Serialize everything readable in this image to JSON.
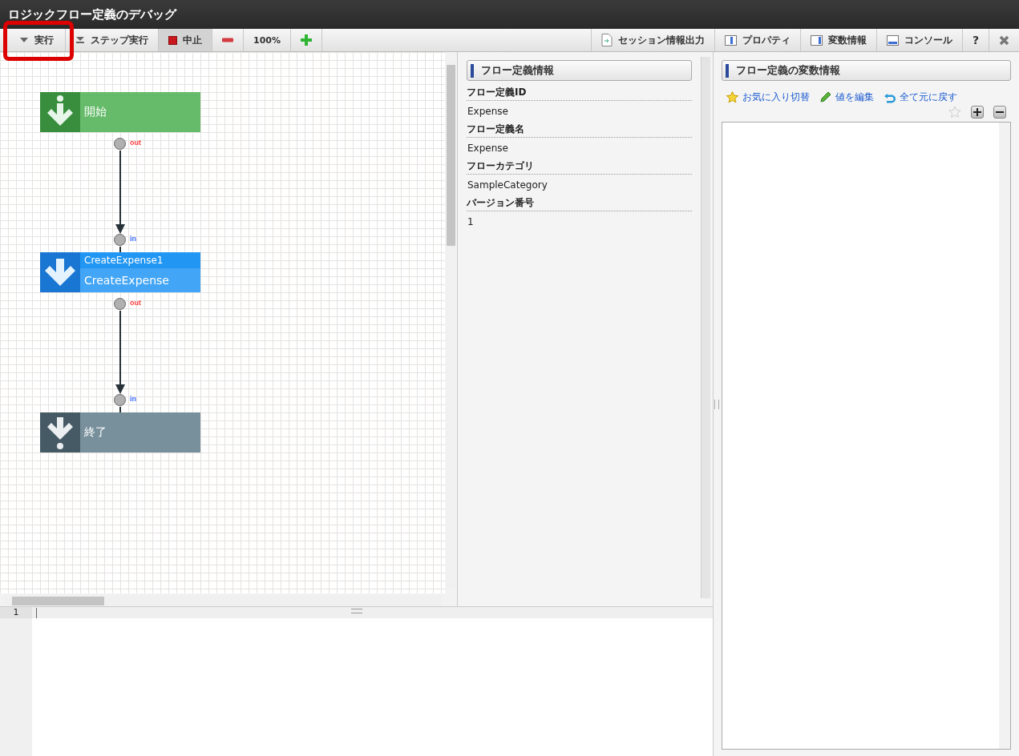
{
  "window": {
    "title": "ロジックフロー定義のデバッグ"
  },
  "toolbar": {
    "left": [
      {
        "kind": "run",
        "label": "実行",
        "highlighted": true,
        "pressed": false
      },
      {
        "kind": "step",
        "label": "ステップ実行",
        "highlighted": false,
        "pressed": false
      },
      {
        "kind": "stop",
        "label": "中止",
        "highlighted": false,
        "pressed": true
      },
      {
        "kind": "zoom-out",
        "highlighted": false,
        "pressed": false
      },
      {
        "kind": "zoom",
        "label": "100%",
        "highlighted": false,
        "pressed": false
      },
      {
        "kind": "zoom-in",
        "highlighted": false,
        "pressed": false
      }
    ],
    "right": [
      {
        "kind": "export",
        "label": "セッション情報出力"
      },
      {
        "kind": "properties",
        "label": "プロパティ"
      },
      {
        "kind": "variables",
        "label": "変数情報"
      },
      {
        "kind": "console",
        "label": "コンソール"
      },
      {
        "kind": "help",
        "label": "?"
      },
      {
        "kind": "close"
      }
    ]
  },
  "flow": {
    "nodes": [
      {
        "kind": "start",
        "label": "開始",
        "out": "out"
      },
      {
        "kind": "task",
        "id": "CreateExpense1",
        "label": "CreateExpense",
        "in": "in",
        "out": "out"
      },
      {
        "kind": "end",
        "label": "終了",
        "in": "in"
      }
    ]
  },
  "properties": {
    "title": "フロー定義情報",
    "fields": [
      {
        "label": "フロー定義ID",
        "value": "Expense"
      },
      {
        "label": "フロー定義名",
        "value": "Expense"
      },
      {
        "label": "フローカテゴリ",
        "value": "SampleCategory"
      },
      {
        "label": "バージョン番号",
        "value": "1"
      }
    ]
  },
  "variables": {
    "title": "フロー定義の変数情報",
    "actions": [
      {
        "kind": "favorite",
        "label": "お気に入り切替"
      },
      {
        "kind": "edit",
        "label": "値を編集"
      },
      {
        "kind": "revert",
        "label": "全て元に戻す"
      }
    ]
  },
  "editor": {
    "line_numbers": [
      "1"
    ]
  }
}
